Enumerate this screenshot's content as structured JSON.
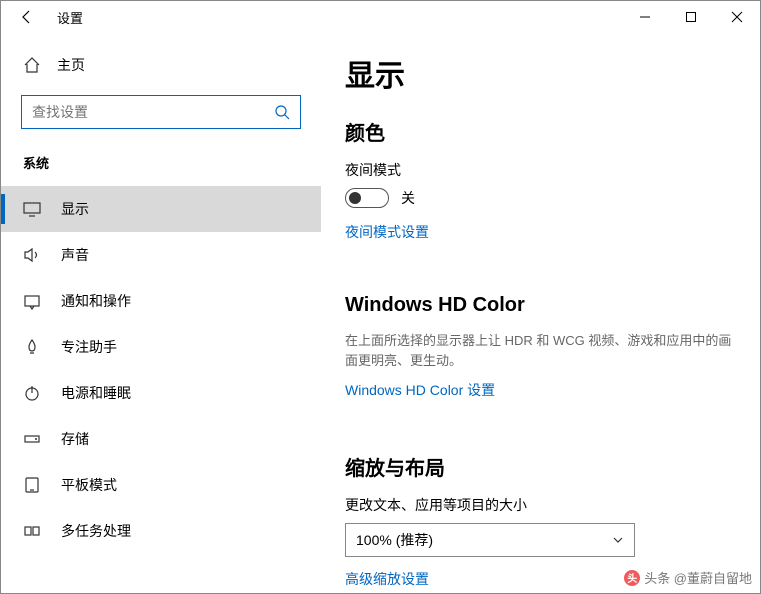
{
  "titlebar": {
    "title": "设置"
  },
  "sidebar": {
    "home": "主页",
    "search_placeholder": "查找设置",
    "category": "系统",
    "items": [
      {
        "label": "显示",
        "icon": "monitor-icon",
        "selected": true
      },
      {
        "label": "声音",
        "icon": "sound-icon"
      },
      {
        "label": "通知和操作",
        "icon": "notification-icon"
      },
      {
        "label": "专注助手",
        "icon": "focus-icon"
      },
      {
        "label": "电源和睡眠",
        "icon": "power-icon"
      },
      {
        "label": "存储",
        "icon": "storage-icon"
      },
      {
        "label": "平板模式",
        "icon": "tablet-icon"
      },
      {
        "label": "多任务处理",
        "icon": "multitask-icon"
      }
    ]
  },
  "main": {
    "page_title": "显示",
    "color_heading": "颜色",
    "night_mode_label": "夜间模式",
    "night_mode_state": "关",
    "night_mode_link": "夜间模式设置",
    "hd_heading": "Windows HD Color",
    "hd_desc": "在上面所选择的显示器上让 HDR 和 WCG 视频、游戏和应用中的画面更明亮、更生动。",
    "hd_link": "Windows HD Color 设置",
    "scale_heading": "缩放与布局",
    "scale_label": "更改文本、应用等项目的大小",
    "scale_value": "100% (推荐)",
    "advanced_scale_link": "高级缩放设置"
  },
  "watermark": "头条 @董蔚自留地"
}
